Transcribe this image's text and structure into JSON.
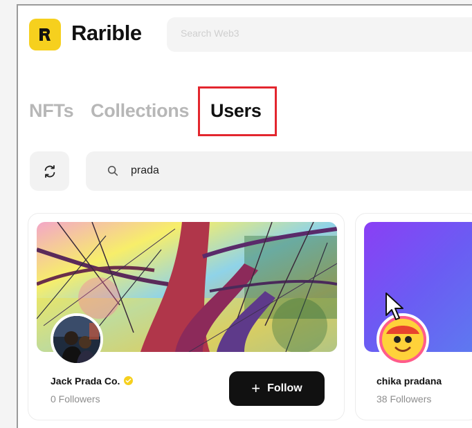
{
  "header": {
    "brand": "Rarible",
    "logo_letter": "R",
    "search_placeholder": "Search Web3"
  },
  "tabs": [
    {
      "label": "NFTs",
      "active": false
    },
    {
      "label": "Collections",
      "active": false
    },
    {
      "label": "Users",
      "active": true
    }
  ],
  "filters": {
    "search_value": "prada"
  },
  "users": [
    {
      "name": "Jack Prada Co.",
      "verified": true,
      "followers": "0 Followers",
      "follow_label": "Follow"
    },
    {
      "name": "chika pradana",
      "verified": false,
      "followers": "38 Followers"
    }
  ],
  "colors": {
    "brand_yellow": "#f6d01e",
    "highlight_red": "#e3262e",
    "button_black": "#111111"
  },
  "icons": {
    "logo": "rarible-logo-icon",
    "refresh": "refresh-icon",
    "search": "search-icon",
    "verified": "verified-badge-icon",
    "plus": "plus-icon",
    "cursor": "mouse-pointer-icon"
  }
}
